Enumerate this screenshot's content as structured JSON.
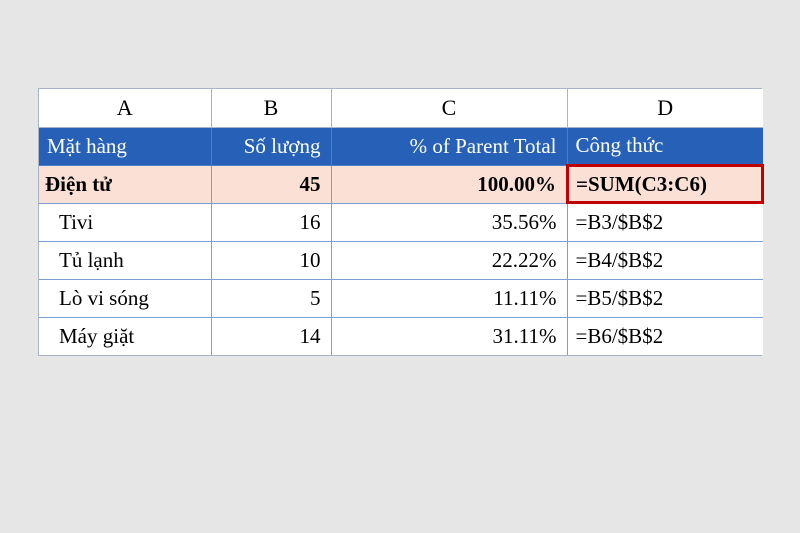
{
  "columns": {
    "A": "A",
    "B": "B",
    "C": "C",
    "D": "D"
  },
  "header": {
    "A": "Mặt hàng",
    "B": "Số lượng",
    "C": "% of Parent Total",
    "D": "Công thức"
  },
  "parent": {
    "A": "Điện tử",
    "B": "45",
    "C": "100.00%",
    "D": "=SUM(C3:C6)"
  },
  "rows": [
    {
      "A": "Tivi",
      "B": "16",
      "C": "35.56%",
      "D": "=B3/$B$2"
    },
    {
      "A": "Tủ lạnh",
      "B": "10",
      "C": "22.22%",
      "D": "=B4/$B$2"
    },
    {
      "A": "Lò vi sóng",
      "B": "5",
      "C": "11.11%",
      "D": "=B5/$B$2"
    },
    {
      "A": "Máy giặt",
      "B": "14",
      "C": "31.11%",
      "D": "=B6/$B$2"
    }
  ],
  "chart_data": {
    "type": "table",
    "title": "% of Parent Total",
    "columns": [
      "Mặt hàng",
      "Số lượng",
      "% of Parent Total",
      "Công thức"
    ],
    "parent_row": {
      "Mặt hàng": "Điện tử",
      "Số lượng": 45,
      "% of Parent Total": 100.0,
      "Công thức": "=SUM(C3:C6)"
    },
    "rows": [
      {
        "Mặt hàng": "Tivi",
        "Số lượng": 16,
        "% of Parent Total": 35.56,
        "Công thức": "=B3/$B$2"
      },
      {
        "Mặt hàng": "Tủ lạnh",
        "Số lượng": 10,
        "% of Parent Total": 22.22,
        "Công thức": "=B4/$B$2"
      },
      {
        "Mặt hàng": "Lò vi sóng",
        "Số lượng": 5,
        "% of Parent Total": 11.11,
        "Công thức": "=B5/$B$2"
      },
      {
        "Mặt hàng": "Máy giặt",
        "Số lượng": 14,
        "% of Parent Total": 31.11,
        "Công thức": "=B6/$B$2"
      }
    ]
  }
}
